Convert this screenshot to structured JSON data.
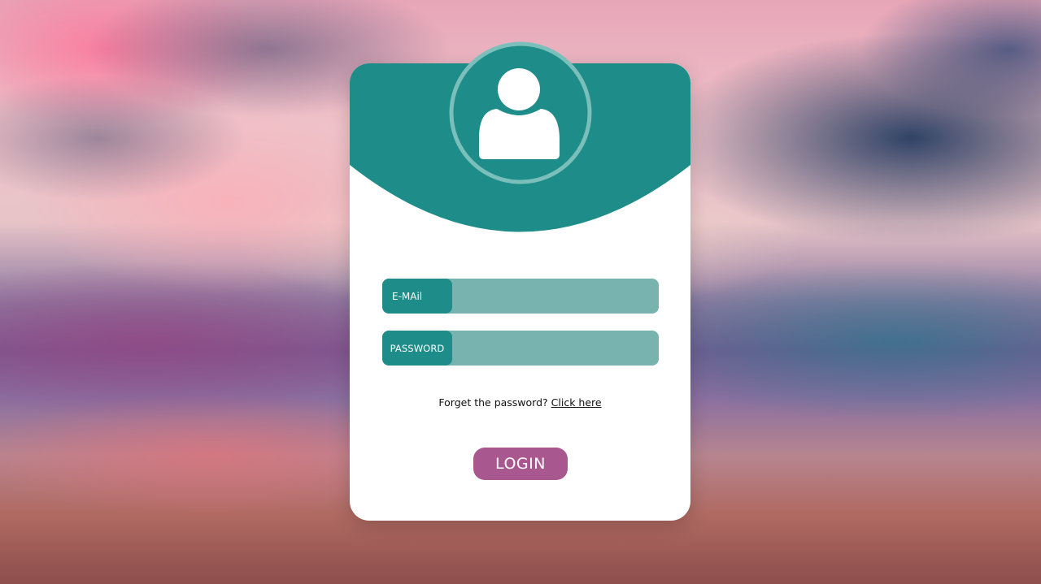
{
  "login_form": {
    "email_label": "E-MAil",
    "email_value": "",
    "password_label": "PASSWORD",
    "password_value": "",
    "forgot_text": "Forget the password?",
    "forgot_link": "Click here",
    "login_button": "LOGIN"
  },
  "icons": {
    "avatar": "user-icon"
  },
  "colors": {
    "teal": "#1e8c88",
    "field_bg": "#78b3b0",
    "avatar_ring": "#7bbfbb",
    "button": "#a9588f",
    "card": "#ffffff"
  }
}
